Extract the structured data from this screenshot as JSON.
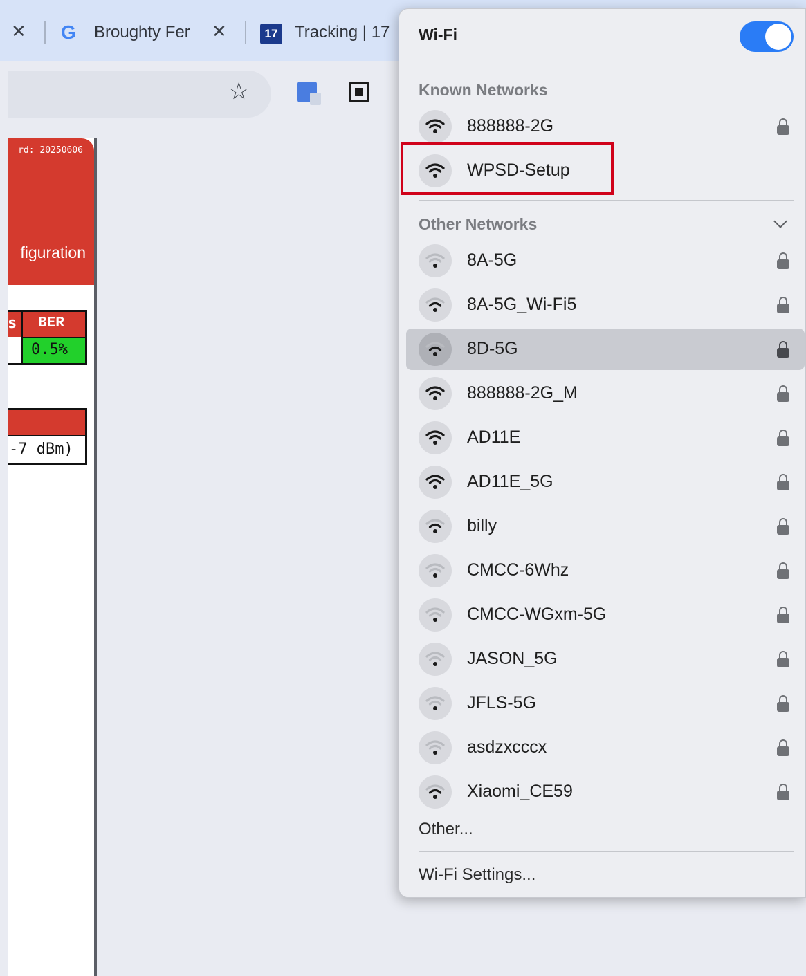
{
  "browser": {
    "tabs": [
      {
        "close_label": "✕"
      },
      {
        "icon_letter": "G",
        "title": "Broughty Fer",
        "close_label": "✕"
      },
      {
        "icon_text": "17",
        "title": "Tracking | 17"
      }
    ],
    "toolbar": {
      "star_icon": "☆"
    }
  },
  "page": {
    "build_text": "rd: 20250606",
    "config_text": "figuration",
    "ber_table": {
      "left_header": "s",
      "header": "BER",
      "value": "0.5%"
    },
    "rssi_table": {
      "value": "-7 dBm)"
    }
  },
  "wifi_menu": {
    "title": "Wi-Fi",
    "toggle_on": true,
    "known_label": "Known Networks",
    "other_label": "Other Networks",
    "known_networks": [
      {
        "name": "888888-2G",
        "locked": true,
        "strength": 3
      },
      {
        "name": "WPSD-Setup",
        "locked": false,
        "strength": 3
      }
    ],
    "other_networks": [
      {
        "name": "8A-5G",
        "locked": true,
        "strength": 1
      },
      {
        "name": "8A-5G_Wi-Fi5",
        "locked": true,
        "strength": 2
      },
      {
        "name": "8D-5G",
        "locked": true,
        "strength": 2
      },
      {
        "name": "888888-2G_M",
        "locked": true,
        "strength": 3
      },
      {
        "name": "AD11E",
        "locked": true,
        "strength": 3
      },
      {
        "name": "AD11E_5G",
        "locked": true,
        "strength": 3
      },
      {
        "name": "billy",
        "locked": true,
        "strength": 2
      },
      {
        "name": "CMCC-6Whz",
        "locked": true,
        "strength": 1
      },
      {
        "name": "CMCC-WGxm-5G",
        "locked": true,
        "strength": 1
      },
      {
        "name": "JASON_5G",
        "locked": true,
        "strength": 1
      },
      {
        "name": "JFLS-5G",
        "locked": true,
        "strength": 1
      },
      {
        "name": "asdzxcccx",
        "locked": true,
        "strength": 1
      },
      {
        "name": "Xiaomi_CE59",
        "locked": true,
        "strength": 2
      }
    ],
    "other_label_link": "Other...",
    "settings_label": "Wi-Fi Settings...",
    "colors": {
      "accent": "#2a7cf6",
      "highlight_border": "#d0021b",
      "header_red": "#d43a2e",
      "ber_green": "#22d02b"
    }
  }
}
